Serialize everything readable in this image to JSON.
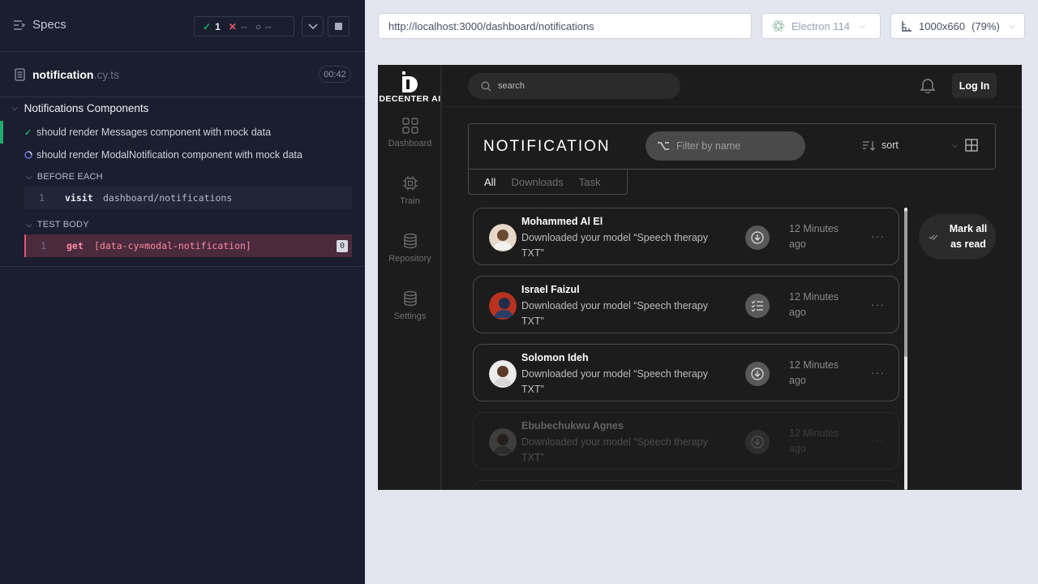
{
  "runner": {
    "specs_label": "Specs",
    "stats": {
      "passed": "1",
      "failed": "--",
      "pending": "--"
    },
    "spec_file": {
      "name": "notification",
      "ext": ".cy.ts",
      "duration": "00:42"
    },
    "suite": "Notifications Components",
    "tests": [
      {
        "label": "should render Messages component with mock data",
        "status": "passed"
      },
      {
        "label": "should render ModalNotification component with mock data",
        "status": "running"
      }
    ],
    "before_each_label": "BEFORE EACH",
    "before_each_cmd": {
      "num": "1",
      "name": "visit",
      "arg": "dashboard/notifications"
    },
    "test_body_label": "TEST BODY",
    "test_body_cmd": {
      "num": "1",
      "name": "get",
      "arg": "[data-cy=modal-notification]",
      "badge": "0"
    }
  },
  "browser": {
    "url": "http://localhost:3000/dashboard/notifications",
    "name": "Electron 114",
    "viewport": "1000x660",
    "zoom": "(79%)"
  },
  "app": {
    "logo_text": "DECENTER AI",
    "nav": [
      {
        "label": "Dashboard",
        "icon": "dashboard-grid-icon"
      },
      {
        "label": "Train",
        "icon": "cpu-chip-icon"
      },
      {
        "label": "Repository",
        "icon": "database-icon"
      },
      {
        "label": "Settings",
        "icon": "database-icon"
      }
    ],
    "search_placeholder": "search",
    "login_label": "Log In",
    "title": "NOTIFICATION",
    "filter_placeholder": "Filter by name",
    "sort_label": "sort",
    "tabs": [
      "All",
      "Downloads",
      "Task"
    ],
    "active_tab": "All",
    "mark_all_read": "Mark all as read",
    "notifications": [
      {
        "name": "Mohammed Al El",
        "message": "Downloaded your model “Speech therapy TXT”",
        "time": "12 Minutes ago",
        "icon": "download-icon"
      },
      {
        "name": "Israel Faizul",
        "message": "Downloaded your model “Speech therapy TXT”",
        "time": "12 Minutes ago",
        "icon": "task-list-icon"
      },
      {
        "name": "Solomon Ideh",
        "message": "Downloaded your model “Speech therapy TXT”",
        "time": "12 Minutes ago",
        "icon": "download-icon"
      },
      {
        "name": "Ebubechukwu Agnes",
        "message": "Downloaded your model “Speech therapy TXT”",
        "time": "12 Minutes ago",
        "icon": "download-icon"
      }
    ],
    "colors": {
      "app_bg": "#1c1c1c",
      "card_border": "#4a4a4a",
      "runner_bg": "#1b1e2e",
      "pass": "#1fa971",
      "fail": "#e45770"
    }
  }
}
